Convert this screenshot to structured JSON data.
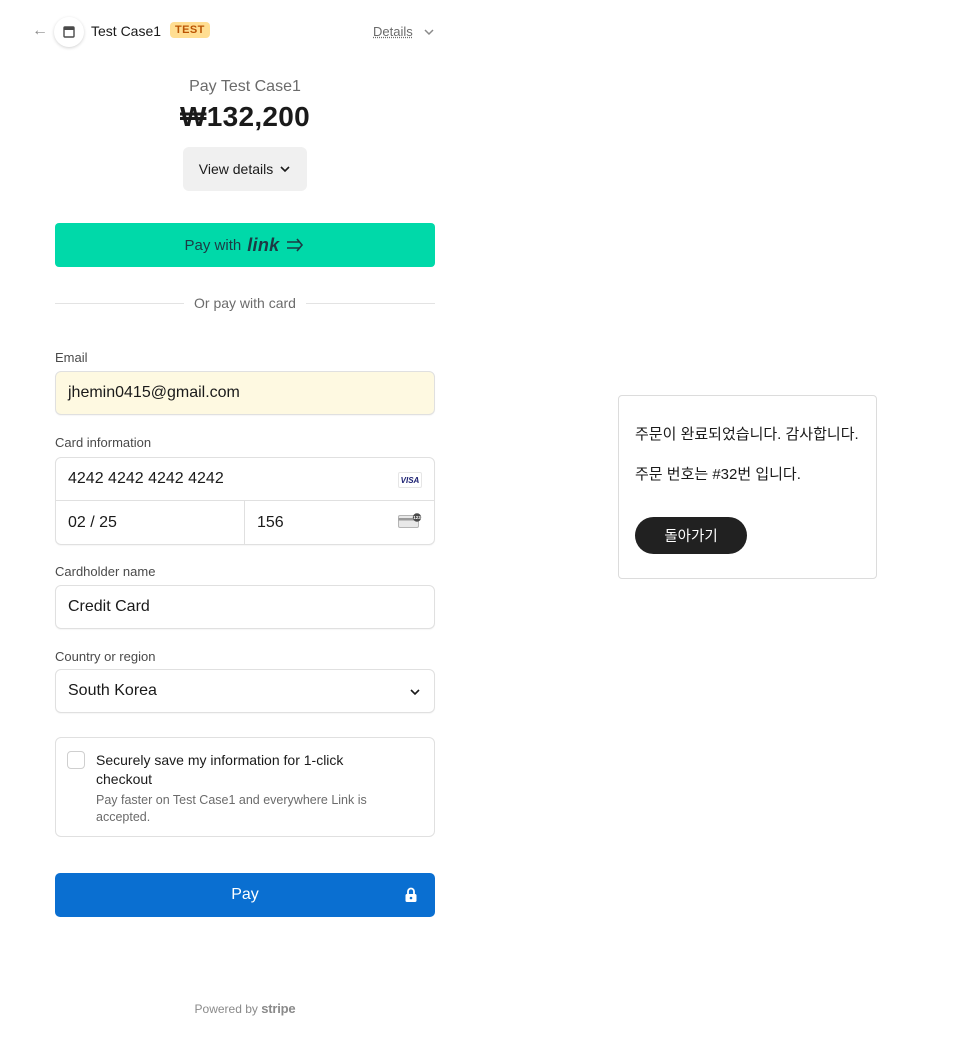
{
  "header": {
    "back_icon": "arrow-left-icon",
    "merchant_name": "Test Case1",
    "badge": "TEST",
    "details_label": "Details"
  },
  "summary": {
    "pay_label": "Pay Test Case1",
    "amount": "₩132,200",
    "view_details_label": "View details"
  },
  "link_pay": {
    "prefix": "Pay with",
    "wordmark": "link",
    "color": "#00d9a9"
  },
  "divider_text": "Or pay with card",
  "form": {
    "email_label": "Email",
    "email_value": "jhemin0415@gmail.com",
    "card_label": "Card information",
    "card_number": "4242 4242 4242 4242",
    "card_brand": "VISA",
    "card_expiry": "02 / 25",
    "card_cvc": "156",
    "cardholder_label": "Cardholder name",
    "cardholder_value": "Credit Card",
    "country_label": "Country or region",
    "country_value": "South Korea"
  },
  "save_info": {
    "title": "Securely save my information for 1-click checkout",
    "description": "Pay faster on Test Case1 and everywhere Link is accepted.",
    "checked": false
  },
  "pay_button": {
    "label": "Pay",
    "color": "#0a6fd1"
  },
  "footer": {
    "powered_by": "Powered by",
    "brand": "stripe"
  },
  "modal": {
    "line1": "주문이 완료되었습니다. 감사합니다.",
    "line2": "주문 번호는 #32번 입니다.",
    "button_label": "돌아가기"
  }
}
